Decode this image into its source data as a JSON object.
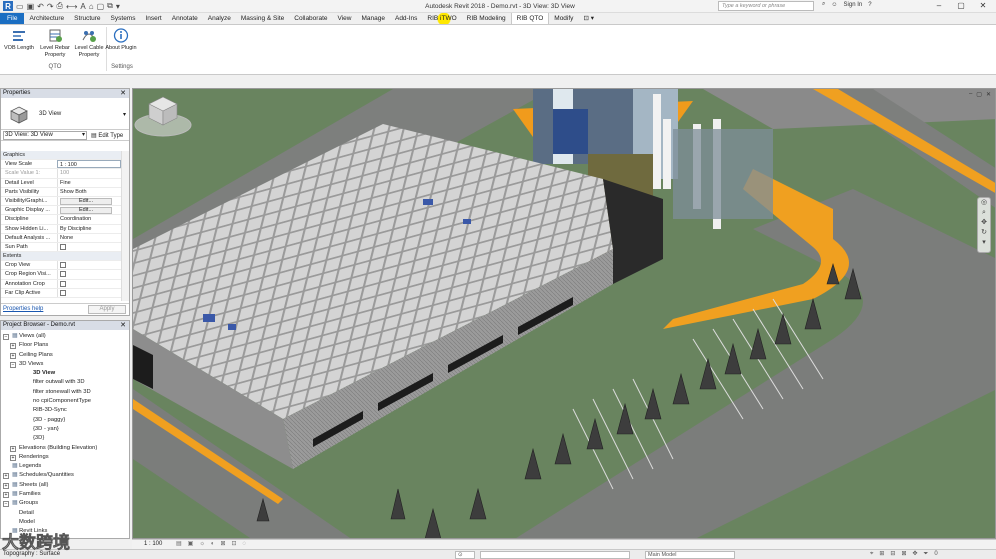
{
  "titlebar": {
    "title": "Autodesk Revit 2018 -   Demo.rvt - 3D View: 3D View",
    "search_placeholder": "Type a keyword or phrase",
    "sign_in": "Sign In",
    "logo": "R"
  },
  "tabs": [
    {
      "label": "File"
    },
    {
      "label": "Architecture"
    },
    {
      "label": "Structure"
    },
    {
      "label": "Systems"
    },
    {
      "label": "Insert"
    },
    {
      "label": "Annotate"
    },
    {
      "label": "Analyze"
    },
    {
      "label": "Massing & Site"
    },
    {
      "label": "Collaborate"
    },
    {
      "label": "View"
    },
    {
      "label": "Manage"
    },
    {
      "label": "Add-Ins"
    },
    {
      "label": "RIB iTWO"
    },
    {
      "label": "RIB Modeling"
    },
    {
      "label": "RIB QTO"
    },
    {
      "label": "Modify"
    }
  ],
  "ribbon": {
    "buttons": [
      {
        "label": "VOB Length"
      },
      {
        "label": "Level Rebar Property"
      },
      {
        "label": "Level Cable Property"
      },
      {
        "label": "About Plugin"
      }
    ],
    "groups": [
      {
        "label": "QTO"
      },
      {
        "label": "Settings"
      }
    ]
  },
  "properties": {
    "header": "Properties",
    "type_name": "3D View",
    "instance_selector": "3D View: 3D View",
    "edit_type": "Edit Type",
    "rows": [
      {
        "k": "Graphics",
        "v": "",
        "cat": true
      },
      {
        "k": "View Scale",
        "v": "1 : 100"
      },
      {
        "k": "Scale Value    1:",
        "v": "100",
        "dim": true
      },
      {
        "k": "Detail Level",
        "v": "Fine"
      },
      {
        "k": "Parts Visibility",
        "v": "Show Both"
      },
      {
        "k": "Visibility/Graphi...",
        "v": "Edit...",
        "btn": true
      },
      {
        "k": "Graphic Display ...",
        "v": "Edit...",
        "btn": true
      },
      {
        "k": "Discipline",
        "v": "Coordination"
      },
      {
        "k": "Show Hidden Li...",
        "v": "By Discipline"
      },
      {
        "k": "Default Analysis ...",
        "v": "None"
      },
      {
        "k": "Sun Path",
        "v": "",
        "chk": true
      },
      {
        "k": "Extents",
        "v": "",
        "cat": true
      },
      {
        "k": "Crop View",
        "v": "",
        "chk": true
      },
      {
        "k": "Crop Region Visi...",
        "v": "",
        "chk": true
      },
      {
        "k": "Annotation Crop",
        "v": "",
        "chk": true
      },
      {
        "k": "Far Clip Active",
        "v": "",
        "chk": true
      }
    ],
    "help": "Properties help",
    "apply": "Apply"
  },
  "browser": {
    "header": "Project Browser - Demo.rvt",
    "nodes": [
      {
        "label": "Views (all)",
        "indent": 1,
        "tog": "-",
        "icon": true
      },
      {
        "label": "Floor Plans",
        "indent": 2,
        "tog": "+"
      },
      {
        "label": "Ceiling Plans",
        "indent": 2,
        "tog": "+"
      },
      {
        "label": "3D Views",
        "indent": 2,
        "tog": "-"
      },
      {
        "label": "3D View",
        "indent": 4,
        "bold": true
      },
      {
        "label": "filter outwall with 3D",
        "indent": 4
      },
      {
        "label": "filter stonewall with 3D",
        "indent": 4
      },
      {
        "label": "no cpiComponentType",
        "indent": 4
      },
      {
        "label": "RIB-3D-Sync",
        "indent": 4
      },
      {
        "label": "{3D - paggy}",
        "indent": 4
      },
      {
        "label": "{3D - yan}",
        "indent": 4
      },
      {
        "label": "{3D}",
        "indent": 4
      },
      {
        "label": "Elevations (Building Elevation)",
        "indent": 2,
        "tog": "+"
      },
      {
        "label": "Renderings",
        "indent": 2,
        "tog": "+"
      },
      {
        "label": "Legends",
        "indent": 1,
        "icon": true
      },
      {
        "label": "Schedules/Quantities",
        "indent": 1,
        "tog": "+",
        "icon": true
      },
      {
        "label": "Sheets (all)",
        "indent": 1,
        "tog": "+",
        "icon": true
      },
      {
        "label": "Families",
        "indent": 1,
        "tog": "+",
        "icon": true
      },
      {
        "label": "Groups",
        "indent": 1,
        "tog": "-",
        "icon": true
      },
      {
        "label": "Detail",
        "indent": 2
      },
      {
        "label": "Model",
        "indent": 2
      },
      {
        "label": "Revit Links",
        "indent": 1,
        "icon": true
      }
    ]
  },
  "viewport": {
    "scale": "1 : 100"
  },
  "status": {
    "text": "Topography : Surface",
    "workset_value": "0",
    "model_value": "Main Model",
    "right_value": "0"
  },
  "watermark": {
    "text": "大数跨境"
  },
  "colors": {
    "accent": "#1b6ec2",
    "ground": "#6a8560",
    "road": "#808080",
    "orange": "#f0a020"
  }
}
